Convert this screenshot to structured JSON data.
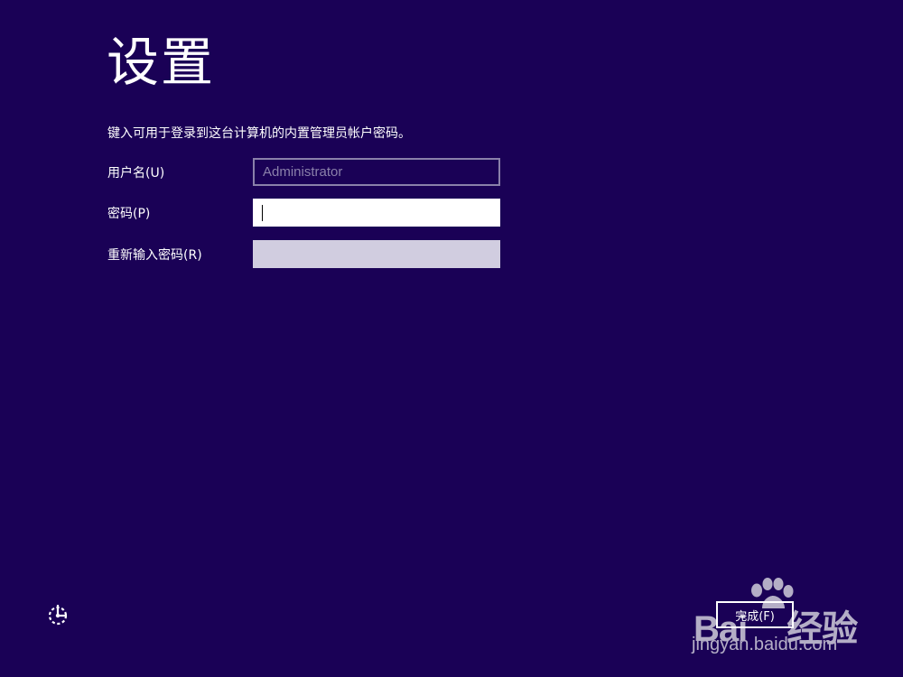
{
  "page": {
    "title": "设置",
    "instruction": "键入可用于登录到这台计算机的内置管理员帐户密码。"
  },
  "form": {
    "username": {
      "label": "用户名(U)",
      "placeholder": "Administrator",
      "value": ""
    },
    "password": {
      "label": "密码(P)",
      "value": ""
    },
    "reenter_password": {
      "label": "重新输入密码(R)",
      "value": ""
    }
  },
  "footer": {
    "ease_of_access_icon": "ease-of-access-icon",
    "finish_label": "完成(F)"
  },
  "watermark": {
    "brand_left": "Bai",
    "brand_right": "经验",
    "url": "jingyan.baidu.com"
  },
  "colors": {
    "background": "#1a0156",
    "text": "#ffffff",
    "disabled_field_border": "#8a80aa",
    "active_field": "#ffffff",
    "inactive_field": "#d1cde0"
  }
}
